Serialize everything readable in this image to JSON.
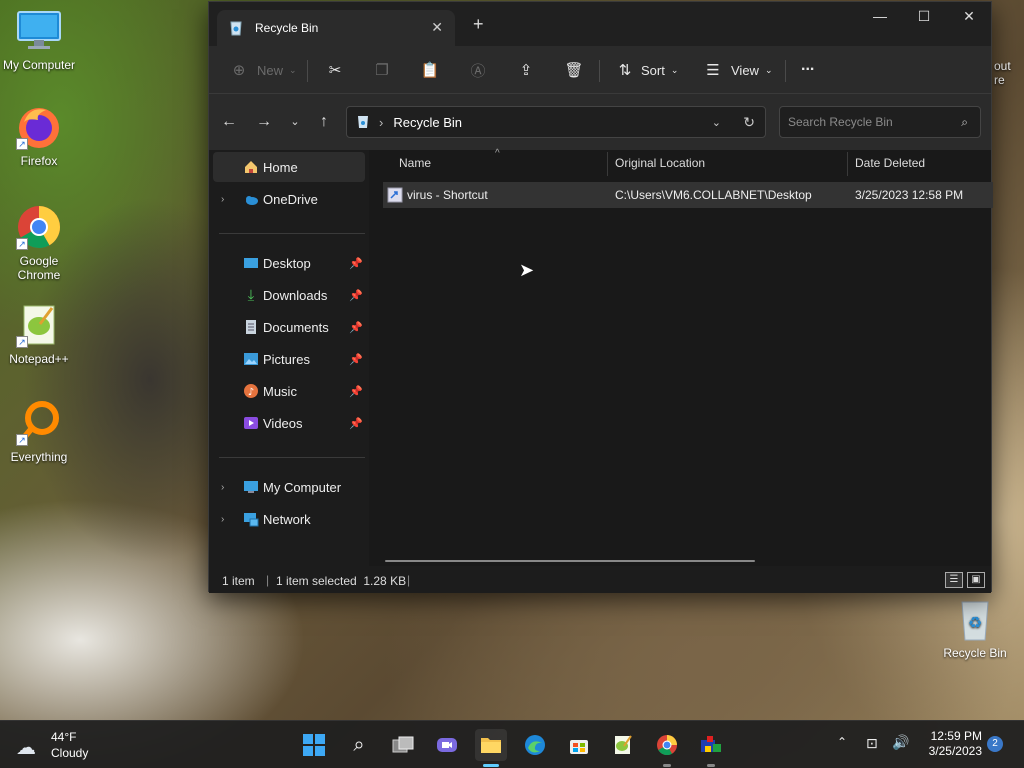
{
  "desktop": {
    "icons": [
      {
        "label": "My Computer"
      },
      {
        "label": "Firefox"
      },
      {
        "label": "Google Chrome"
      },
      {
        "label": "Notepad++"
      },
      {
        "label": "Everything"
      },
      {
        "label": "Recycle Bin"
      }
    ],
    "partial_text_right": [
      "out",
      "re"
    ]
  },
  "window": {
    "tab_title": "Recycle Bin",
    "toolbar": {
      "new_label": "New",
      "sort_label": "Sort",
      "view_label": "View",
      "more_label": "..."
    },
    "address": {
      "path": "Recycle Bin",
      "search_placeholder": "Search Recycle Bin"
    },
    "sidebar": {
      "home": "Home",
      "onedrive": "OneDrive",
      "quick_access": [
        "Desktop",
        "Downloads",
        "Documents",
        "Pictures",
        "Music",
        "Videos"
      ],
      "my_computer": "My Computer",
      "network": "Network"
    },
    "columns": {
      "name": "Name",
      "original_location": "Original Location",
      "date_deleted": "Date Deleted"
    },
    "rows": [
      {
        "name": "virus - Shortcut",
        "original_location": "C:\\Users\\VM6.COLLABNET\\Desktop",
        "date_deleted": "3/25/2023 12:58 PM"
      }
    ],
    "status": {
      "count": "1 item",
      "selected": "1 item selected  1.28 KB"
    }
  },
  "taskbar": {
    "weather_temp": "44°F",
    "weather_desc": "Cloudy",
    "time": "12:59 PM",
    "date": "3/25/2023",
    "notification_count": "2"
  },
  "colors": {
    "accent": "#60cdff",
    "window_bg": "#1c1c1c",
    "selected_row": "#333333"
  }
}
